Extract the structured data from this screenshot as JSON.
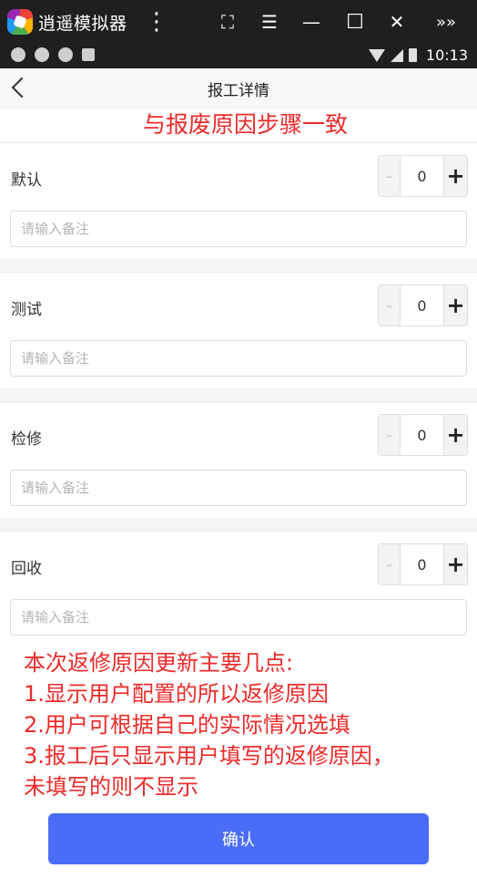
{
  "emulator": {
    "title": "逍遥模拟器",
    "menu_icon": "more-vert-icon",
    "buttons": [
      "screenshot-icon",
      "menu-icon",
      "minimize-icon",
      "maximize-icon",
      "close-icon",
      "expand-icon"
    ],
    "glyphs": {
      "more": "⋮",
      "screenshot": "⛶",
      "menu": "☰",
      "minimize": "—",
      "maximize": "☐",
      "close": "✕",
      "expand": "»»"
    }
  },
  "status_bar": {
    "time": "10:13"
  },
  "header": {
    "title": "报工详情"
  },
  "annotation_top": "与报废原因步骤一致",
  "reasons": [
    {
      "label": "默认",
      "quantity": "0",
      "minus": "-",
      "plus": "+",
      "note_placeholder": "请输入备注",
      "note_value": ""
    },
    {
      "label": "测试",
      "quantity": "0",
      "minus": "-",
      "plus": "+",
      "note_placeholder": "请输入备注",
      "note_value": ""
    },
    {
      "label": "检修",
      "quantity": "0",
      "minus": "-",
      "plus": "+",
      "note_placeholder": "请输入备注",
      "note_value": ""
    },
    {
      "label": "回收",
      "quantity": "0",
      "minus": "-",
      "plus": "+",
      "note_placeholder": "请输入备注",
      "note_value": ""
    }
  ],
  "annotation_bottom": [
    "本次返修原因更新主要几点:",
    "1.显示用户配置的所以返修原因",
    "2.用户可根据自己的实际情况选填",
    "3.报工后只显示用户填写的返修原因，",
    "未填写的则不显示"
  ],
  "confirm_label": "确认",
  "colors": {
    "accent": "#4a6cf7",
    "annotation": "#ee2b2b"
  }
}
